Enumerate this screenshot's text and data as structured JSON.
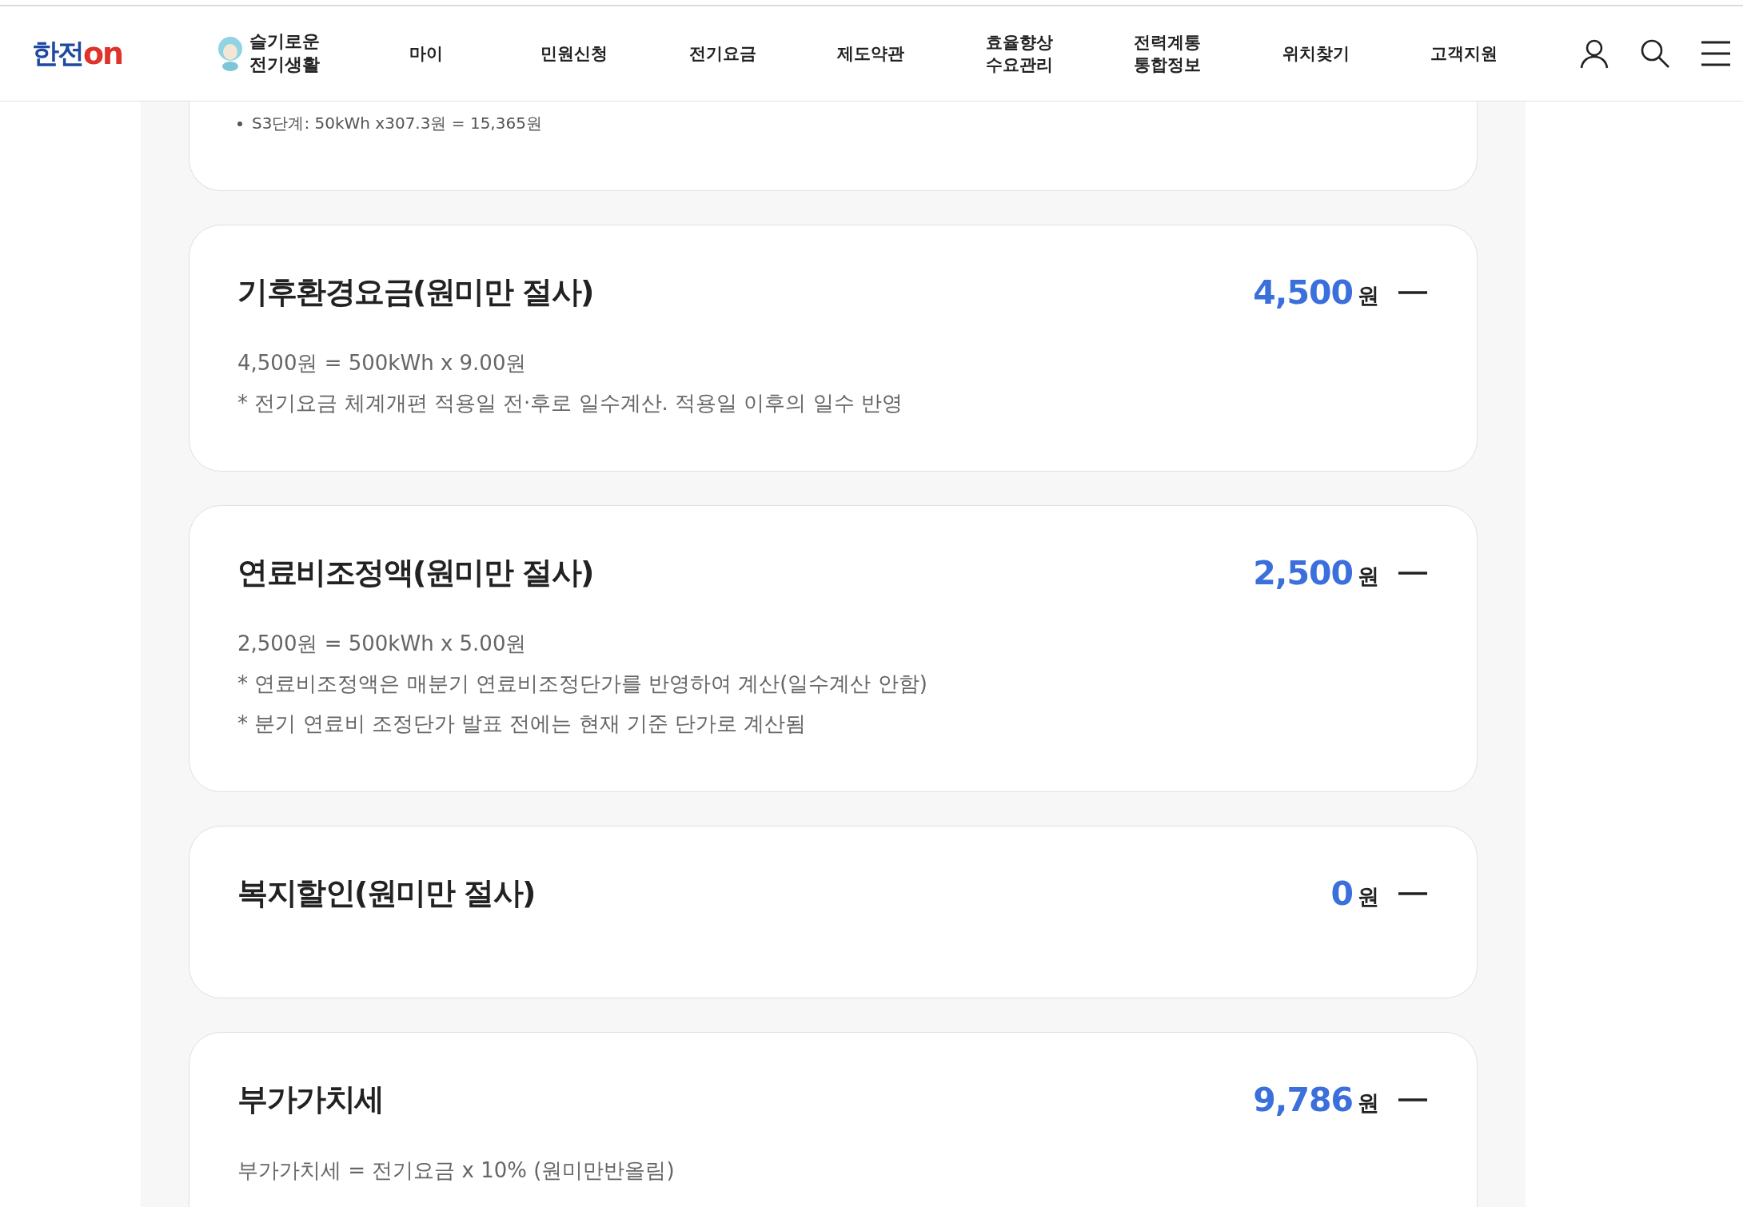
{
  "header": {
    "logo": {
      "text": "한전",
      "suffix": "on"
    },
    "mascot_label": [
      "슬기로운",
      "전기생활"
    ],
    "nav": [
      [
        "마이"
      ],
      [
        "민원신청"
      ],
      [
        "전기요금"
      ],
      [
        "제도약관"
      ],
      [
        "효율향상",
        "수요관리"
      ],
      [
        "전력계통",
        "통합정보"
      ],
      [
        "위치찾기"
      ],
      [
        "고객지원"
      ]
    ]
  },
  "partial_card": {
    "bullets": [
      "S3단계: 50kWh x307.3원 = 15,365원"
    ]
  },
  "cards": [
    {
      "title": "기후환경요금(원미만 절사)",
      "amount": "4,500",
      "unit": "원",
      "expanded": true,
      "details": [
        "4,500원 = 500kWh x 9.00원",
        "* 전기요금 체계개편 적용일 전·후로 일수계산. 적용일 이후의 일수 반영"
      ]
    },
    {
      "title": "연료비조정액(원미만 절사)",
      "amount": "2,500",
      "unit": "원",
      "expanded": true,
      "details": [
        "2,500원 = 500kWh x 5.00원",
        "* 연료비조정액은 매분기 연료비조정단가를 반영하여 계산(일수계산 안함)",
        "* 분기 연료비 조정단가 발표 전에는 현재 기준 단가로 계산됨"
      ]
    },
    {
      "title": "복지할인(원미만 절사)",
      "amount": "0",
      "unit": "원",
      "expanded": true
    },
    {
      "title": "부가가치세",
      "amount": "9,786",
      "unit": "원",
      "expanded": true,
      "details": [
        "부가가치세 = 전기요금 x 10% (원미만반올림)"
      ]
    }
  ]
}
